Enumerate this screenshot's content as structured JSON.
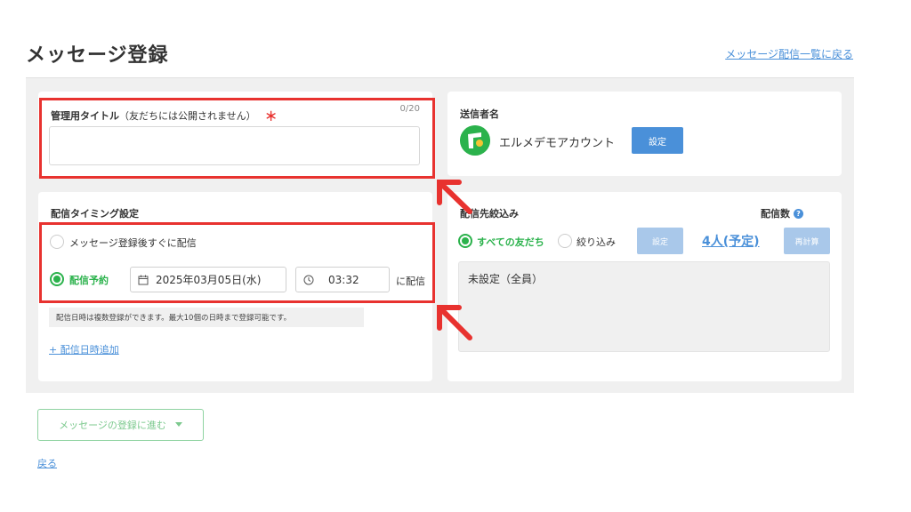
{
  "page": {
    "title": "メッセージ登録",
    "back_to_list": "メッセージ配信一覧に戻る"
  },
  "title_field": {
    "label": "管理用タイトル",
    "sub_label": "（友だちには公開されません）",
    "required_mark": "＊",
    "counter": "0/20",
    "value": "",
    "placeholder": ""
  },
  "sender": {
    "label": "送信者名",
    "name": "エルメデモアカウント",
    "setting_button": "設定"
  },
  "timing": {
    "label": "配信タイミング設定",
    "option_immediate": "メッセージ登録後すぐに配信",
    "option_scheduled": "配信予約",
    "selected": "scheduled",
    "date": "2025年03月05日(水)",
    "time": "03:32",
    "suffix": "に配信",
    "note": "配信日時は複数登録ができます。最大10個の日時まで登録可能です。",
    "add_link": "+ 配信日時追加"
  },
  "target": {
    "label": "配信先絞込み",
    "count_label": "配信数",
    "option_all": "すべての友だち",
    "option_filter": "絞り込み",
    "selected": "all",
    "setting_button": "設定",
    "count_value": "4人(予定)",
    "recalc_button": "再計算",
    "summary": "未設定（全員）"
  },
  "footer": {
    "proceed_button": "メッセージの登録に進む",
    "back_link": "戻る"
  },
  "colors": {
    "accent_blue": "#4a90d9",
    "accent_green": "#2bb24c",
    "highlight_red": "#e8322f",
    "panel_bg": "#f0f0f0"
  }
}
